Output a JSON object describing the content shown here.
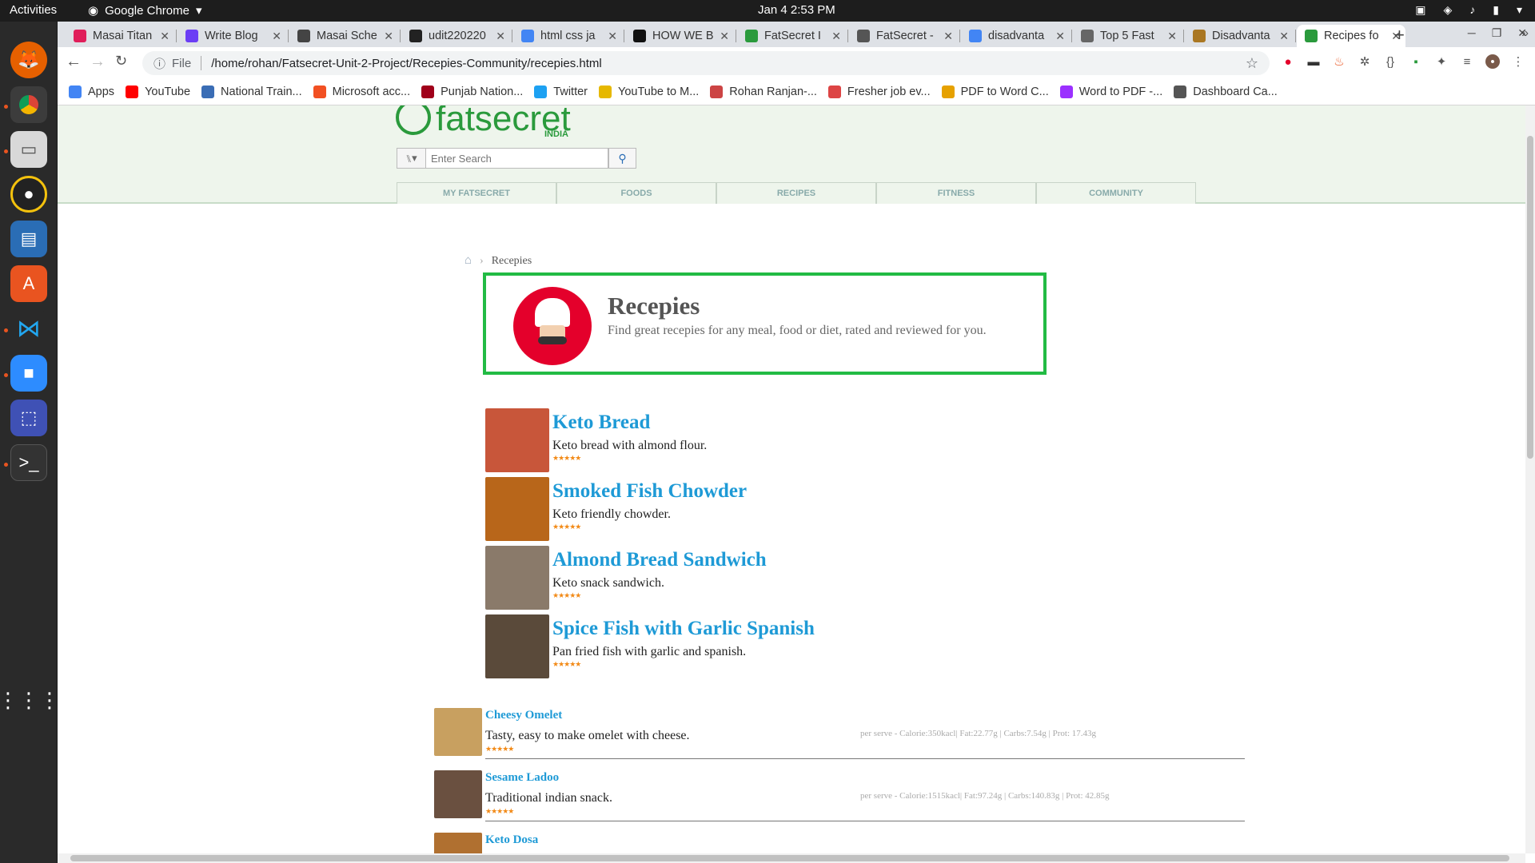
{
  "system_bar": {
    "activities": "Activities",
    "app_name": "Google Chrome",
    "clock": "Jan 4  2:53 PM"
  },
  "dock": {
    "items": [
      "firefox-icon",
      "chrome-icon",
      "files-icon",
      "rhythmbox-icon",
      "writer-icon",
      "software-center-icon",
      "vscode-icon",
      "zoom-icon",
      "screenshot-icon",
      "terminal-icon",
      "app-grid-icon"
    ]
  },
  "browser": {
    "tabs": [
      {
        "label": "Masai Titan",
        "color": "#e01e5a"
      },
      {
        "label": "Write Blog",
        "color": "#6b3df5"
      },
      {
        "label": "Masai Sche",
        "color": "#444444"
      },
      {
        "label": "udit220220",
        "color": "#222222"
      },
      {
        "label": "html css ja",
        "color": "#4285f4"
      },
      {
        "label": "HOW WE B",
        "color": "#111111"
      },
      {
        "label": "FatSecret I",
        "color": "#2a9a3c"
      },
      {
        "label": "FatSecret -",
        "color": "#555555"
      },
      {
        "label": "disadvanta",
        "color": "#4285f4"
      },
      {
        "label": "Top 5 Fast",
        "color": "#666666"
      },
      {
        "label": "Disadvanta",
        "color": "#aa7722"
      },
      {
        "label": "Recipes fo",
        "color": "#2a9a3c"
      }
    ],
    "url_scheme": "File",
    "url": "/home/rohan/Fatsecret-Unit-2-Project/Recepies-Community/recepies.html",
    "bookmarks": [
      {
        "label": "Apps",
        "color": "#4285f4"
      },
      {
        "label": "YouTube",
        "color": "#ff0000"
      },
      {
        "label": "National Train...",
        "color": "#3a6db5"
      },
      {
        "label": "Microsoft acc...",
        "color": "#f25022"
      },
      {
        "label": "Punjab Nation...",
        "color": "#a0001a"
      },
      {
        "label": "Twitter",
        "color": "#1da1f2"
      },
      {
        "label": "YouTube to M...",
        "color": "#e6b800"
      },
      {
        "label": "Rohan Ranjan-...",
        "color": "#cc4444"
      },
      {
        "label": "Fresher job ev...",
        "color": "#dd4444"
      },
      {
        "label": "PDF to Word C...",
        "color": "#e6a100"
      },
      {
        "label": "Word to PDF -...",
        "color": "#9b30ff"
      },
      {
        "label": "Dashboard Ca...",
        "color": "#555555"
      }
    ]
  },
  "site": {
    "logo_text": "fatsecret",
    "logo_region": "INDIA",
    "search_placeholder": "Enter Search",
    "nav": [
      "MY FATSECRET",
      "FOODS",
      "RECIPES",
      "FITNESS",
      "COMMUNITY"
    ],
    "breadcrumb_current": "Recepies",
    "hero": {
      "title": "Recepies",
      "subtitle": "Find great recepies for any meal, food or diet, rated and reviewed for you."
    },
    "featured": [
      {
        "title": "Keto Bread",
        "desc": "Keto bread with almond flour.",
        "stars": "★★★★★",
        "thumb": "#c8563a"
      },
      {
        "title": "Smoked Fish Chowder",
        "desc": "Keto friendly chowder.",
        "stars": "★★★★★",
        "thumb": "#b8661a"
      },
      {
        "title": "Almond Bread Sandwich",
        "desc": "Keto snack sandwich.",
        "stars": "★★★★★",
        "thumb": "#8a7a6a"
      },
      {
        "title": "Spice Fish with Garlic Spanish",
        "desc": "Pan fried fish with garlic and spanish.",
        "stars": "★★★★★",
        "thumb": "#5a4a3a"
      }
    ],
    "list": [
      {
        "title": "Cheesy Omelet",
        "desc": "Tasty, easy to make omelet with cheese.",
        "stars": "★★★★★",
        "nutrition": "per serve - Calorie:350kacl| Fat:22.77g | Carbs:7.54g | Prot: 17.43g",
        "thumb": "#c8a060"
      },
      {
        "title": "Sesame Ladoo",
        "desc": "Traditional indian snack.",
        "stars": "★★★★★",
        "nutrition": "per serve - Calorie:1515kacl| Fat:97.24g | Carbs:140.83g | Prot: 42.85g",
        "thumb": "#6a5040"
      },
      {
        "title": "Keto Dosa",
        "desc": "",
        "stars": "",
        "nutrition": "",
        "thumb": "#b07030"
      }
    ]
  }
}
